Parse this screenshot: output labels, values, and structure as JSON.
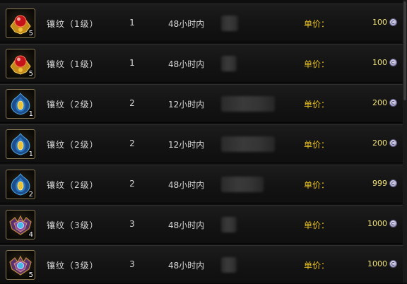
{
  "unit_price_label": "单价：",
  "rows": [
    {
      "name": "镶纹（1级）",
      "level": "1",
      "duration": "48小时内",
      "price": "100",
      "qty": "5",
      "icon": "gold-red-gem-icon"
    },
    {
      "name": "镶纹（1级）",
      "level": "1",
      "duration": "48小时内",
      "price": "100",
      "qty": "5",
      "icon": "gold-red-gem-icon"
    },
    {
      "name": "镶纹（2级）",
      "level": "2",
      "duration": "12小时内",
      "price": "200",
      "qty": "1",
      "icon": "blue-flame-gem-icon"
    },
    {
      "name": "镶纹（2级）",
      "level": "2",
      "duration": "12小时内",
      "price": "200",
      "qty": "1",
      "icon": "blue-flame-gem-icon"
    },
    {
      "name": "镶纹（2级）",
      "level": "2",
      "duration": "48小时内",
      "price": "999",
      "qty": "2",
      "icon": "blue-flame-gem-icon"
    },
    {
      "name": "镶纹（3级）",
      "level": "3",
      "duration": "48小时内",
      "price": "1000",
      "qty": "4",
      "icon": "purple-crest-gem-icon"
    },
    {
      "name": "镶纹（3级）",
      "level": "3",
      "duration": "48小时内",
      "price": "1000",
      "qty": "5",
      "icon": "purple-crest-gem-icon"
    }
  ],
  "colors": {
    "label": "#e8c020",
    "price": "#f0e27a",
    "text": "#d7d7d7"
  }
}
